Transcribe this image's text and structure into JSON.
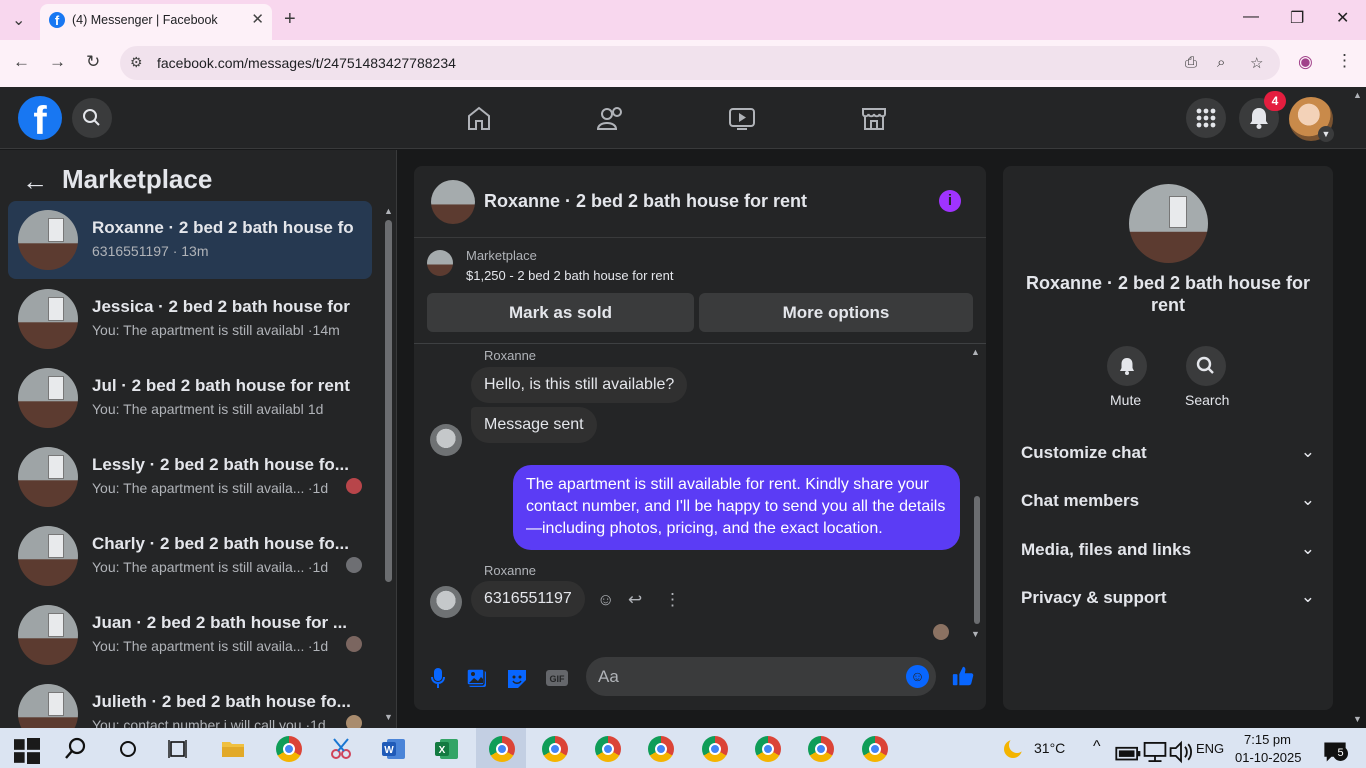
{
  "browser": {
    "tab_title": "(4) Messenger | Facebook",
    "url": "facebook.com/messages/t/24751483427788234"
  },
  "header": {
    "notification_count": "4"
  },
  "sidebar": {
    "title": "Marketplace",
    "conversations": [
      {
        "name": "Roxanne · 2 bed 2 bath house fo...",
        "snippet": "6316551197",
        "time": "· 13m",
        "active": true
      },
      {
        "name": "Jessica · 2 bed 2 bath house for r...",
        "snippet": "You: The apartment is still availabl...",
        "time": "·14m",
        "active": false
      },
      {
        "name": "Jul · 2 bed 2 bath house for rent",
        "snippet": "You: The apartment is still available ...",
        "time": "1d",
        "active": false
      },
      {
        "name": "Lessly · 2 bed 2 bath house fo...",
        "snippet": "You: The apartment is still availa...",
        "time": "·1d",
        "active": false
      },
      {
        "name": "Charly · 2 bed 2 bath house fo...",
        "snippet": "You: The apartment is still availa...",
        "time": "·1d",
        "active": false
      },
      {
        "name": "Juan · 2 bed 2 bath house for ...",
        "snippet": "You: The apartment is still availa...",
        "time": "·1d",
        "active": false
      },
      {
        "name": "Julieth · 2 bed 2 bath house fo...",
        "snippet": "You: contact number i will call you",
        "time": "·1d",
        "active": false
      }
    ]
  },
  "chat": {
    "title": "Roxanne · 2 bed 2 bath house for rent",
    "listing_label": "Marketplace",
    "listing_item": "$1,250 - 2 bed 2 bath house for rent",
    "mark_sold": "Mark as sold",
    "more_options": "More options",
    "messages": [
      {
        "sender": "Roxanne",
        "text": "Hello, is this still available?"
      },
      {
        "sender": "",
        "text": "Message sent"
      },
      {
        "sender": "me",
        "text": "The apartment is still available for rent. Kindly share your contact number, and I'll be happy to send you all the details—including photos, pricing, and the exact location."
      },
      {
        "sender": "Roxanne",
        "text": "6316551197"
      }
    ],
    "composer_placeholder": "Aa"
  },
  "info_panel": {
    "name": "Roxanne · 2 bed 2 bath house for rent",
    "mute": "Mute",
    "search": "Search",
    "sections": [
      "Customize chat",
      "Chat members",
      "Media, files and links",
      "Privacy & support"
    ]
  },
  "taskbar": {
    "temperature": "31°C",
    "language": "ENG",
    "time": "7:15 pm",
    "date": "01-10-2025",
    "notification_count": "5"
  }
}
